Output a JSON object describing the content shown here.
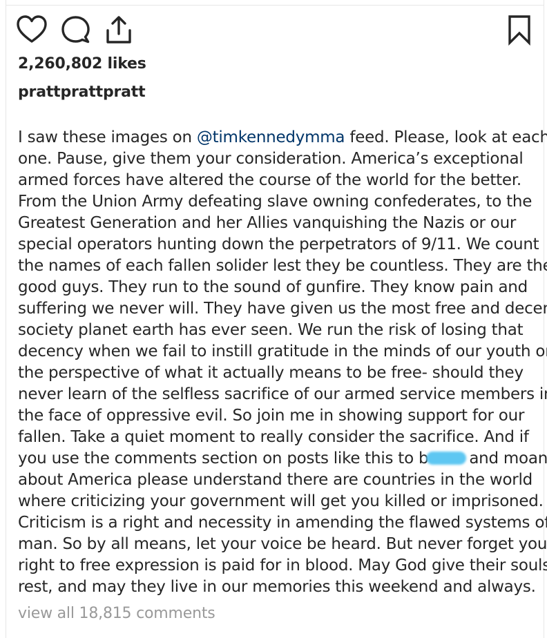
{
  "post": {
    "likes_count": "2,260,802",
    "likes_suffix": "likes",
    "likes_text": "2,260,802 likes",
    "username": "prattprattpratt",
    "caption": {
      "line1_before": "I saw these images on ",
      "mention": "@timkennedymma",
      "line1_after": " feed. Please, look at each",
      "lines_2_to_15": [
        "one. Pause, give them your consideration. America’s exceptional",
        "armed forces have altered the course of the world for the better.",
        "From the Union Army defeating slave owning confederates, to the",
        "Greatest Generation and her Allies vanquishing the Nazis or our",
        "special operators hunting down the perpetrators of 9/11. We count",
        "the names of each fallen solider lest they be countless. They are the",
        "good guys. They run to the sound of gunfire. They know pain and",
        "suffering we never will. They have given us the most free and decent",
        "society planet earth has ever seen. We run the risk of losing that",
        "decency when we fail to instill gratitude in the minds of our youth or",
        "the perspective of what it actually means to be free- should they",
        "never learn of the selfless sacrifice of our armed service members in",
        "the face of oppressive evil. So join me in showing support for our",
        "fallen. Take a quiet moment to really consider the sacrifice. And if"
      ],
      "line16_before": "you use the comments section on posts like this to b",
      "line16_after": "and moan",
      "lines_17_to_22": [
        "about America please understand there are countries in the world",
        "where criticizing your government will get you killed or imprisoned.",
        "Criticism is a right and necessity in amending the flawed systems of",
        "man. So by all means, let your voice be heard. But never forget your",
        "right to free expression is paid for in blood. May God give their souls",
        "rest, and may they live in our memories this weekend and always."
      ]
    },
    "view_comments": "view all 18,815 comments"
  },
  "icons": {
    "like": "heart-outline-icon",
    "comment": "speech-bubble-icon",
    "share": "share-upload-icon",
    "save": "bookmark-outline-icon"
  },
  "colors": {
    "text": "#262626",
    "mention": "#003569",
    "muted": "#999999",
    "redaction": "#5ec7f2",
    "divider": "#e6e6e6"
  }
}
